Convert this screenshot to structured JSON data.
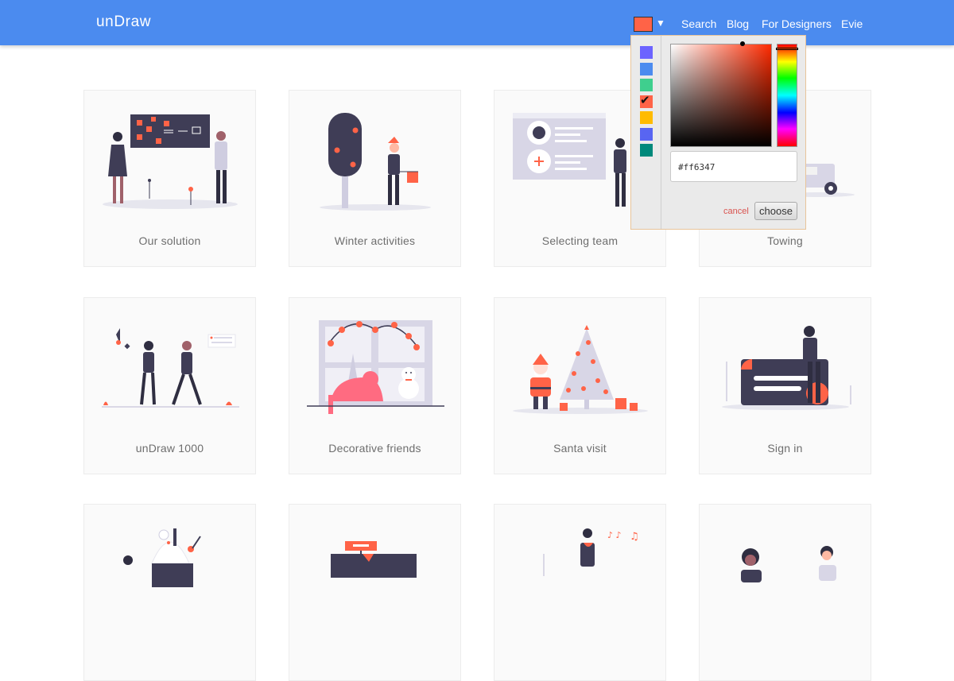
{
  "header": {
    "logo": "unDraw",
    "selected_color": "#ff6347",
    "caret": "▼",
    "nav": [
      "Search",
      "Blog",
      "For Designers",
      "Evie"
    ]
  },
  "cards": [
    {
      "title": "Our solution"
    },
    {
      "title": "Winter activities"
    },
    {
      "title": "Selecting team"
    },
    {
      "title": "Towing"
    },
    {
      "title": "unDraw 1000"
    },
    {
      "title": "Decorative friends"
    },
    {
      "title": "Santa visit"
    },
    {
      "title": "Sign in"
    },
    {
      "title": ""
    },
    {
      "title": ""
    },
    {
      "title": ""
    },
    {
      "title": ""
    }
  ],
  "color_picker": {
    "palette": [
      "#6c63ff",
      "#4b8bef",
      "#3fcf8e",
      "#ff6347",
      "#ffbb00",
      "#5865f2",
      "#00897b"
    ],
    "selected_index": 3,
    "hex_value": "#ff6347",
    "cancel_label": "cancel",
    "choose_label": "choose"
  },
  "colors": {
    "header": "#4b8bef",
    "accent": "#ff6347"
  }
}
